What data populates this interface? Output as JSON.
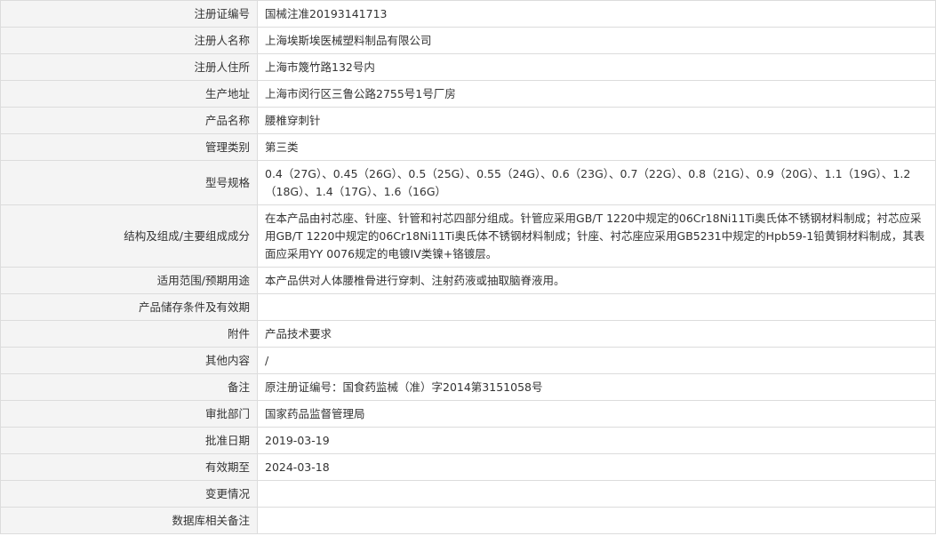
{
  "rows": [
    {
      "label": "注册证编号",
      "value": "国械注准20193141713"
    },
    {
      "label": "注册人名称",
      "value": "上海埃斯埃医械塑料制品有限公司"
    },
    {
      "label": "注册人住所",
      "value": "上海市篾竹路132号内"
    },
    {
      "label": "生产地址",
      "value": "上海市闵行区三鲁公路2755号1号厂房"
    },
    {
      "label": "产品名称",
      "value": "腰椎穿刺针"
    },
    {
      "label": "管理类别",
      "value": "第三类"
    },
    {
      "label": "型号规格",
      "value": "0.4（27G）、0.45（26G）、0.5（25G）、0.55（24G）、0.6（23G）、0.7（22G）、0.8（21G）、0.9（20G）、1.1（19G）、1.2（18G）、1.4（17G）、1.6（16G）"
    },
    {
      "label": "结构及组成/主要组成成分",
      "value": "在本产品由衬芯座、针座、针管和衬芯四部分组成。针管应采用GB/T 1220中规定的06Cr18Ni11Ti奥氏体不锈钢材料制成；衬芯应采用GB/T 1220中规定的06Cr18Ni11Ti奥氏体不锈钢材料制成；针座、衬芯座应采用GB5231中规定的Hpb59-1铅黄铜材料制成，其表面应采用YY 0076规定的电镀IV类镍+铬镀层。"
    },
    {
      "label": "适用范围/预期用途",
      "value": "本产品供对人体腰椎骨进行穿刺、注射药液或抽取脑脊液用。"
    },
    {
      "label": "产品储存条件及有效期",
      "value": ""
    },
    {
      "label": "附件",
      "value": "产品技术要求"
    },
    {
      "label": "其他内容",
      "value": "/"
    },
    {
      "label": "备注",
      "value": "原注册证编号：国食药监械（准）字2014第3151058号"
    },
    {
      "label": "审批部门",
      "value": "国家药品监督管理局"
    },
    {
      "label": "批准日期",
      "value": "2019-03-19"
    },
    {
      "label": "有效期至",
      "value": "2024-03-18"
    },
    {
      "label": "变更情况",
      "value": ""
    },
    {
      "label": "数据库相关备注",
      "value": ""
    }
  ]
}
